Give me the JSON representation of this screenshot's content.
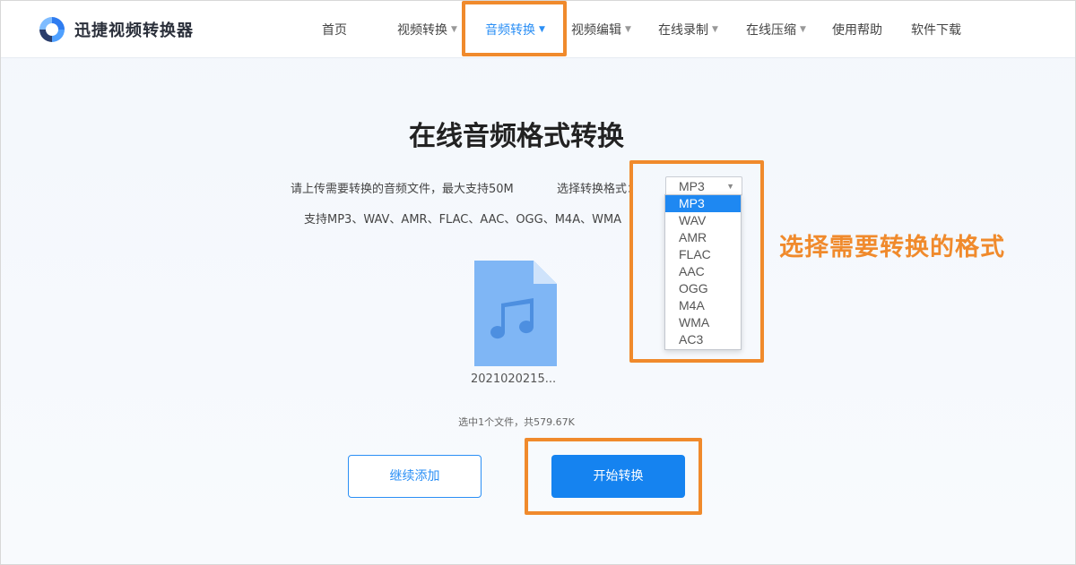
{
  "app": {
    "name": "迅捷视频转换器"
  },
  "nav": {
    "items": [
      {
        "label": "首页",
        "has_dropdown": false,
        "active": false
      },
      {
        "label": "视频转换",
        "has_dropdown": true,
        "active": false
      },
      {
        "label": "音频转换",
        "has_dropdown": true,
        "active": true
      },
      {
        "label": "视频编辑",
        "has_dropdown": true,
        "active": false
      },
      {
        "label": "在线录制",
        "has_dropdown": true,
        "active": false
      },
      {
        "label": "在线压缩",
        "has_dropdown": true,
        "active": false
      },
      {
        "label": "使用帮助",
        "has_dropdown": false,
        "active": false
      },
      {
        "label": "软件下载",
        "has_dropdown": false,
        "active": false
      }
    ]
  },
  "main": {
    "title": "在线音频格式转换",
    "upload_hint": "请上传需要转换的音频文件，最大支持50M",
    "format_label": "选择转换格式：",
    "selected_format": "MP3",
    "supported_formats_text": "支持MP3、WAV、AMR、FLAC、AAC、OGG、M4A、WMA",
    "format_options": [
      "MP3",
      "WAV",
      "AMR",
      "FLAC",
      "AAC",
      "OGG",
      "M4A",
      "WMA",
      "AC3"
    ],
    "file": {
      "name": "2021020215...",
      "icon": "music-file-icon"
    },
    "file_count_text": "选中1个文件，共579.67K",
    "add_more_label": "继续添加",
    "start_label": "开始转换"
  },
  "annotation": {
    "callout_text": "选择需要转换的格式",
    "color": "#f08a2c"
  },
  "colors": {
    "accent": "#2b8ff5",
    "primary_button": "#1583f0",
    "selected_option": "#1e88f2"
  }
}
